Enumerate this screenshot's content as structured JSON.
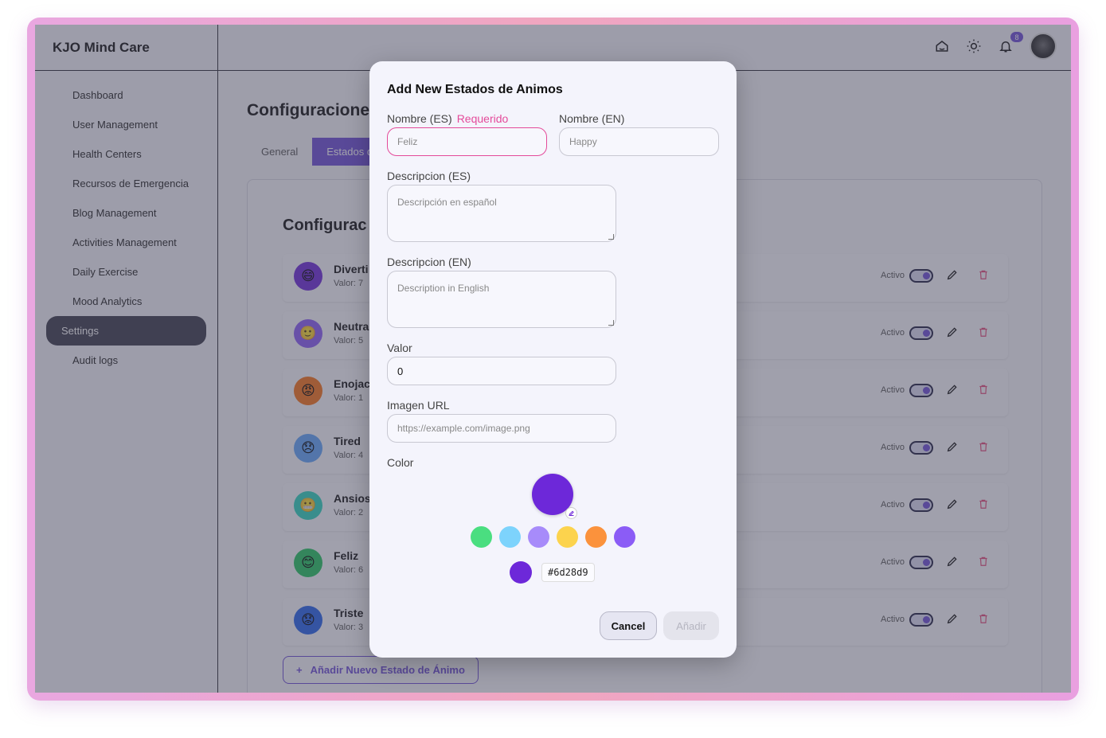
{
  "app": {
    "brand": "KJO Mind Care"
  },
  "sidebar": {
    "items": [
      {
        "label": "Dashboard"
      },
      {
        "label": "User Management"
      },
      {
        "label": "Health Centers"
      },
      {
        "label": "Recursos de Emergencia"
      },
      {
        "label": "Blog Management"
      },
      {
        "label": "Activities Management"
      },
      {
        "label": "Daily Exercise"
      },
      {
        "label": "Mood Analytics"
      },
      {
        "label": "Settings",
        "active": true
      },
      {
        "label": "Audit logs"
      }
    ]
  },
  "topbar": {
    "notification_count": "8",
    "icons": [
      "home-icon",
      "sun-icon",
      "bell-icon"
    ]
  },
  "main": {
    "title": "Configuracione",
    "tabs": [
      {
        "label": "General"
      },
      {
        "label": "Estados de"
      }
    ],
    "panel_title": "Configurac",
    "moods": [
      {
        "name": "Diverti",
        "value": "Valor: 7",
        "status": "Activo",
        "emoji": "😄",
        "color": "#6d28d9"
      },
      {
        "name": "Neutra",
        "value": "Valor: 5",
        "status": "Activo",
        "emoji": "🙂",
        "color": "#8b5cf6"
      },
      {
        "name": "Enojac",
        "value": "Valor: 1",
        "status": "Activo",
        "emoji": "😡",
        "color": "#f97316"
      },
      {
        "name": "Tired",
        "value": "Valor: 4",
        "status": "Activo",
        "emoji": "😞",
        "color": "#60a5fa"
      },
      {
        "name": "Ansios",
        "value": "Valor: 2",
        "status": "Activo",
        "emoji": "😬",
        "color": "#2dd4bf"
      },
      {
        "name": "Feliz",
        "value": "Valor: 6",
        "status": "Activo",
        "emoji": "😊",
        "color": "#22c55e"
      },
      {
        "name": "Triste",
        "value": "Valor: 3",
        "status": "Activo",
        "emoji": "😟",
        "color": "#2563eb"
      }
    ],
    "add_button": "Añadir Nuevo Estado de Ánimo"
  },
  "modal": {
    "title": "Add New Estados de Animos",
    "nombre_es": {
      "label": "Nombre (ES)",
      "required": "Requerido",
      "placeholder": "Feliz"
    },
    "nombre_en": {
      "label": "Nombre (EN)",
      "placeholder": "Happy"
    },
    "desc_es": {
      "label": "Descripcion (ES)",
      "placeholder": "Descripción en español"
    },
    "desc_en": {
      "label": "Descripcion (EN)",
      "placeholder": "Description in English"
    },
    "valor": {
      "label": "Valor",
      "value": "0"
    },
    "imagen": {
      "label": "Imagen URL",
      "placeholder": "https://example.com/image.png"
    },
    "color": {
      "label": "Color",
      "selected": "#6d28d9",
      "presets": [
        "#4ade80",
        "#7dd3fc",
        "#a78bfa",
        "#fcd34d",
        "#fb923c",
        "#8b5cf6"
      ]
    },
    "cancel": "Cancel",
    "submit": "Añadir"
  }
}
